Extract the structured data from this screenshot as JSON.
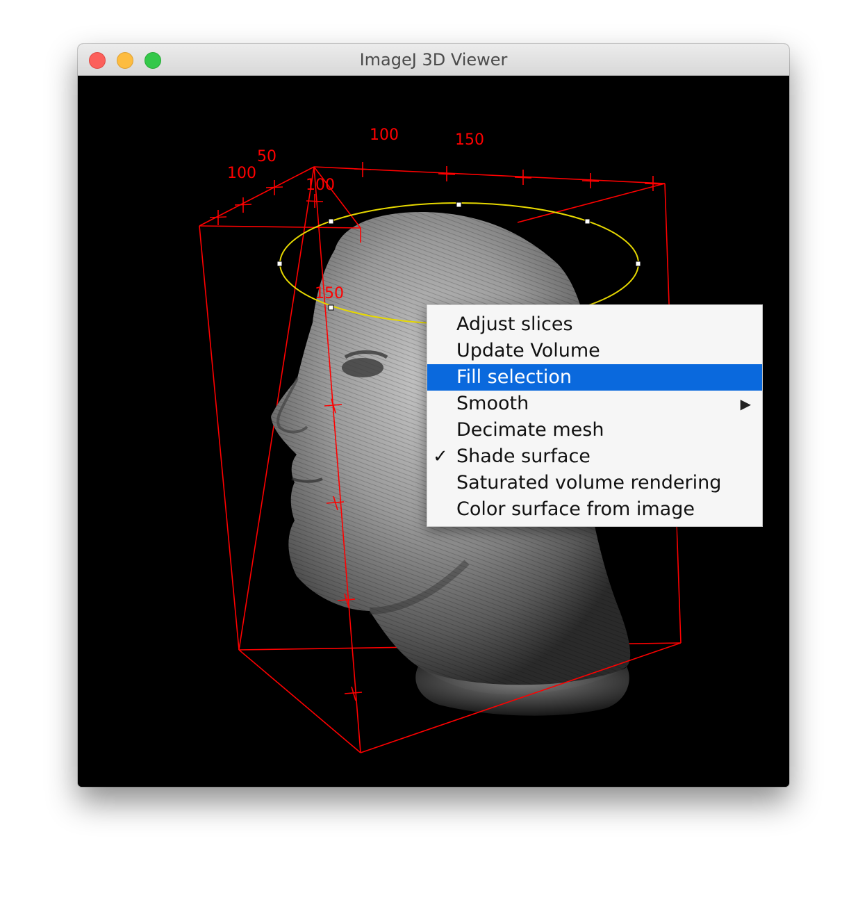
{
  "window": {
    "title": "ImageJ 3D Viewer"
  },
  "bounding_box_labels": {
    "top_100": "100",
    "top_150": "150",
    "left_50": "50",
    "left_100": "100",
    "front_100": "100",
    "front_150": "150"
  },
  "context_menu": {
    "items": [
      {
        "label": "Adjust slices"
      },
      {
        "label": "Update Volume"
      },
      {
        "label": "Fill selection",
        "selected": true
      },
      {
        "label": "Smooth",
        "submenu": true
      },
      {
        "label": "Decimate mesh"
      },
      {
        "label": "Shade surface",
        "checked": true,
        "check_glyph": "✓"
      },
      {
        "label": "Saturated volume rendering"
      },
      {
        "label": "Color surface from image"
      }
    ],
    "submenu_arrow": "▶"
  },
  "colors": {
    "bounding_box": "#ff0000",
    "roi_ellipse": "#e6d800",
    "menu_highlight": "#0a69dd"
  }
}
